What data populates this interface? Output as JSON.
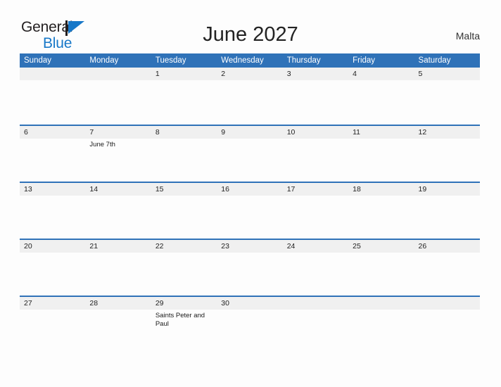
{
  "brand": {
    "word1": "General",
    "word2": "Blue",
    "flag_icon": "blue-triangle-flag",
    "accent_color": "#1878c8"
  },
  "header": {
    "title": "June 2027",
    "country": "Malta"
  },
  "calendar": {
    "header_color": "#2f72b8",
    "band_color": "#f0f0f0",
    "weekdays": [
      "Sunday",
      "Monday",
      "Tuesday",
      "Wednesday",
      "Thursday",
      "Friday",
      "Saturday"
    ],
    "weeks": [
      [
        {
          "date": ""
        },
        {
          "date": ""
        },
        {
          "date": "1"
        },
        {
          "date": "2"
        },
        {
          "date": "3"
        },
        {
          "date": "4"
        },
        {
          "date": "5"
        }
      ],
      [
        {
          "date": "6"
        },
        {
          "date": "7",
          "event": "June 7th"
        },
        {
          "date": "8"
        },
        {
          "date": "9"
        },
        {
          "date": "10"
        },
        {
          "date": "11"
        },
        {
          "date": "12"
        }
      ],
      [
        {
          "date": "13"
        },
        {
          "date": "14"
        },
        {
          "date": "15"
        },
        {
          "date": "16"
        },
        {
          "date": "17"
        },
        {
          "date": "18"
        },
        {
          "date": "19"
        }
      ],
      [
        {
          "date": "20"
        },
        {
          "date": "21"
        },
        {
          "date": "22"
        },
        {
          "date": "23"
        },
        {
          "date": "24"
        },
        {
          "date": "25"
        },
        {
          "date": "26"
        }
      ],
      [
        {
          "date": "27"
        },
        {
          "date": "28"
        },
        {
          "date": "29",
          "event": "Saints Peter and Paul"
        },
        {
          "date": "30"
        },
        {
          "date": ""
        },
        {
          "date": ""
        },
        {
          "date": ""
        }
      ]
    ]
  }
}
